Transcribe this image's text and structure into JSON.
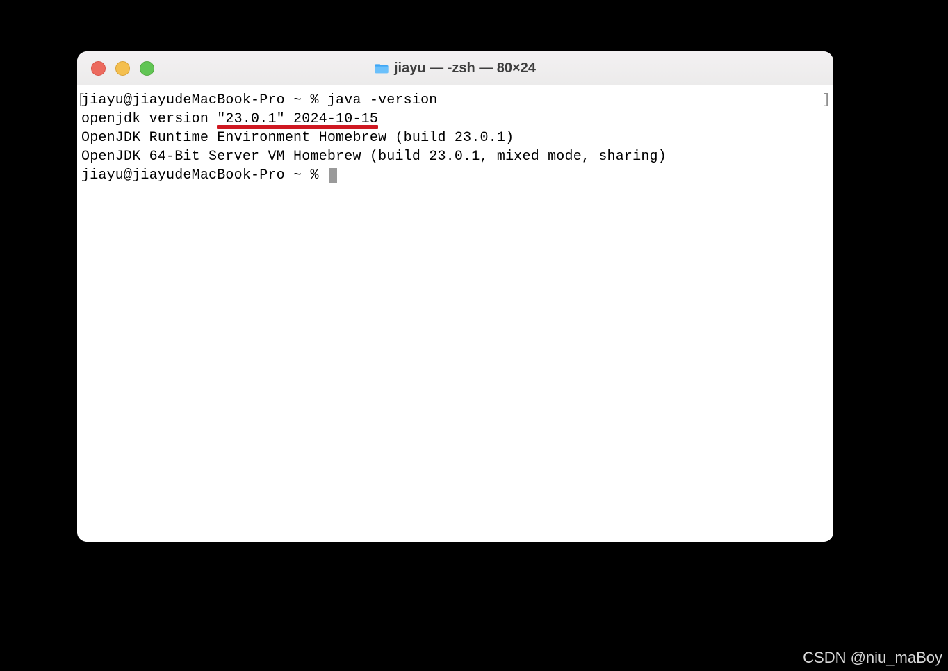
{
  "window": {
    "title": "jiayu — -zsh — 80×24"
  },
  "terminal": {
    "lines": [
      "jiayu@jiayudeMacBook-Pro ~ % java -version",
      "openjdk version \"23.0.1\" 2024-10-15",
      "OpenJDK Runtime Environment Homebrew (build 23.0.1)",
      "OpenJDK 64-Bit Server VM Homebrew (build 23.0.1, mixed mode, sharing)"
    ],
    "prompt": "jiayu@jiayudeMacBook-Pro ~ % "
  },
  "annotation": {
    "underline_target": "\"23.0.1\" 2024-10-15"
  },
  "watermark": "CSDN @niu_maBoy"
}
